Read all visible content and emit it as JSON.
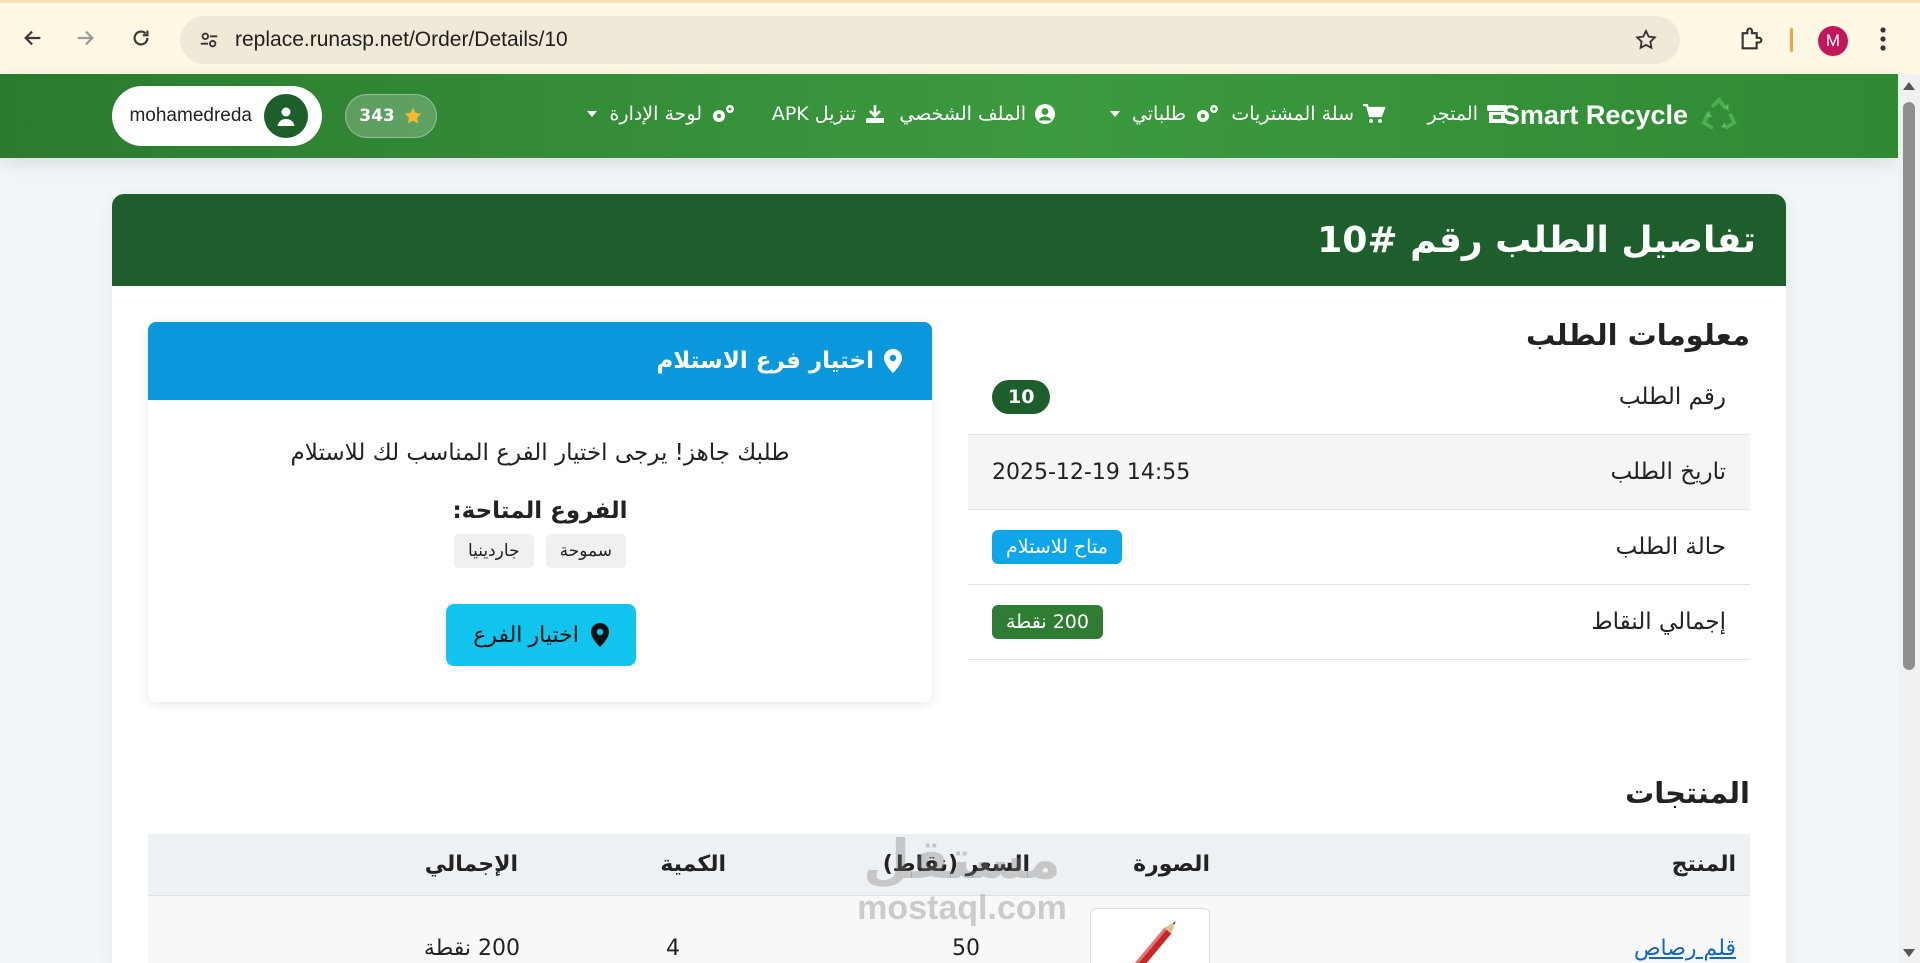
{
  "browser": {
    "url": "replace.runasp.net/Order/Details/10",
    "profile_initial": "M"
  },
  "navbar": {
    "brand": "Smart Recycle",
    "items": [
      {
        "label": "المتجر",
        "icon": "store-icon"
      },
      {
        "label": "سلة المشتريات",
        "icon": "cart-icon"
      },
      {
        "label": "طلباتي",
        "icon": "gears-icon",
        "dropdown": true
      },
      {
        "label": "الملف الشخصي",
        "icon": "user-circle-icon"
      },
      {
        "label": "تنزيل APK",
        "icon": "download-icon"
      },
      {
        "label": "لوحة الإدارة",
        "icon": "gears-icon",
        "dropdown": true
      }
    ],
    "points": "343",
    "username": "mohamedreda"
  },
  "page": {
    "title": "تفاصيل الطلب رقم #10",
    "order_info": {
      "heading": "معلومات الطلب",
      "rows": [
        {
          "label": "رقم الطلب",
          "value": "10"
        },
        {
          "label": "تاريخ الطلب",
          "value": "2025-12-19 14:55"
        },
        {
          "label": "حالة الطلب",
          "value": "متاح للاستلام"
        },
        {
          "label": "إجمالي النقاط",
          "value": "200 نقطة"
        }
      ]
    },
    "branch": {
      "heading": "اختيار فرع الاستلام",
      "message": "طلبك جاهز! يرجى اختيار الفرع المناسب لك للاستلام",
      "available_label": "الفروع المتاحة:",
      "branches": [
        "سموحة",
        "جاردينيا"
      ],
      "button": "اختيار الفرع"
    },
    "products": {
      "heading": "المنتجات",
      "columns": [
        "المنتج",
        "الصورة",
        "السعر (نقاط)",
        "الكمية",
        "الإجمالي"
      ],
      "rows": [
        {
          "name": "قلم رصاص",
          "price": "50",
          "qty": "4",
          "total": "200 نقطة"
        }
      ]
    }
  },
  "watermark": {
    "ar": "مستقل",
    "en": "mostaql.com"
  },
  "colors": {
    "nav_green": "#2b7a2f",
    "header_green": "#1d5e2c",
    "info_blue": "#0b97dc",
    "cyan_button": "#12c5ee"
  }
}
